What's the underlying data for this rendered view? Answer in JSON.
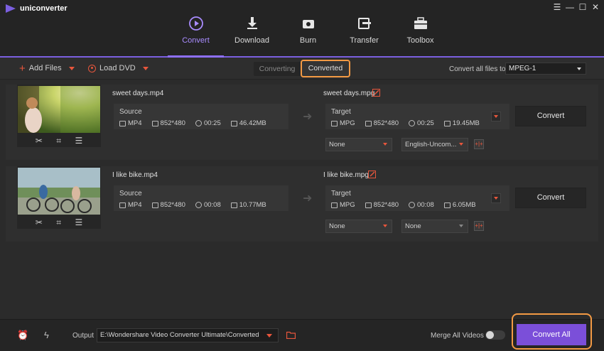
{
  "app": {
    "title": "uniconverter"
  },
  "window_controls": {
    "menu": "☰",
    "minimize": "—",
    "maximize": "☐",
    "close": "✕"
  },
  "nav": [
    {
      "label": "Convert",
      "icon": "convert-icon",
      "active": true
    },
    {
      "label": "Download",
      "icon": "download-icon",
      "active": false
    },
    {
      "label": "Burn",
      "icon": "burn-icon",
      "active": false
    },
    {
      "label": "Transfer",
      "icon": "transfer-icon",
      "active": false
    },
    {
      "label": "Toolbox",
      "icon": "toolbox-icon",
      "active": false
    }
  ],
  "toolbar": {
    "add_files": "Add Files",
    "load_dvd": "Load DVD",
    "tab_converting": "Converting",
    "tab_converted": "Converted",
    "convert_all_to_label": "Convert all files to:",
    "format": "MPEG-1"
  },
  "files": [
    {
      "source_name": "sweet days.mp4",
      "source_label": "Source",
      "source_format": "MP4",
      "source_res": "852*480",
      "source_duration": "00:25",
      "source_size": "46.42MB",
      "target_name": "sweet days.mpg",
      "target_label": "Target",
      "target_format": "MPG",
      "target_res": "852*480",
      "target_duration": "00:25",
      "target_size": "19.45MB",
      "convert": "Convert",
      "subtitle": "None",
      "audio": "English-Uncom..."
    },
    {
      "source_name": "I like bike.mp4",
      "source_label": "Source",
      "source_format": "MP4",
      "source_res": "852*480",
      "source_duration": "00:08",
      "source_size": "10.77MB",
      "target_name": "I like bike.mpg",
      "target_label": "Target",
      "target_format": "MPG",
      "target_res": "852*480",
      "target_duration": "00:08",
      "target_size": "6.05MB",
      "convert": "Convert",
      "subtitle": "None",
      "audio": "None"
    }
  ],
  "bottom": {
    "output_label": "Output",
    "output_path": "E:\\Wondershare Video Converter Ultimate\\Converted",
    "merge_label": "Merge All Videos",
    "merge_on": false,
    "convert_all": "Convert All"
  },
  "colors": {
    "accent": "#7b4fd9",
    "highlight": "#f39a44",
    "icon_red": "#e8563c"
  }
}
